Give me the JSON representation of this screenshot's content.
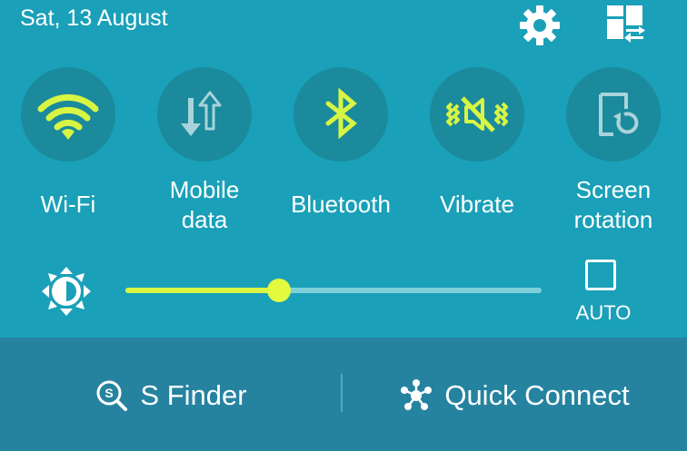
{
  "header": {
    "date": "Sat, 13 August"
  },
  "colors": {
    "panel": "#1aa0b8",
    "toggle_bg": "#1a8a9c",
    "accent": "#d7f542",
    "bottom_bar": "#2583a0"
  },
  "toggles": [
    {
      "label": "Wi-Fi",
      "icon": "wifi-icon",
      "active": true
    },
    {
      "label_lines": [
        "Mobile",
        "data"
      ],
      "icon": "mobile-data-icon",
      "active": false
    },
    {
      "label": "Bluetooth",
      "icon": "bluetooth-icon",
      "active": true
    },
    {
      "label": "Vibrate",
      "icon": "vibrate-icon",
      "active": true
    },
    {
      "label_lines": [
        "Screen",
        "rotation"
      ],
      "icon": "screen-rotation-icon",
      "active": false
    }
  ],
  "brightness": {
    "level": 0.37,
    "auto_label": "AUTO",
    "auto_checked": false
  },
  "bottom_bar": {
    "s_finder_label": "S Finder",
    "quick_connect_label": "Quick Connect"
  }
}
